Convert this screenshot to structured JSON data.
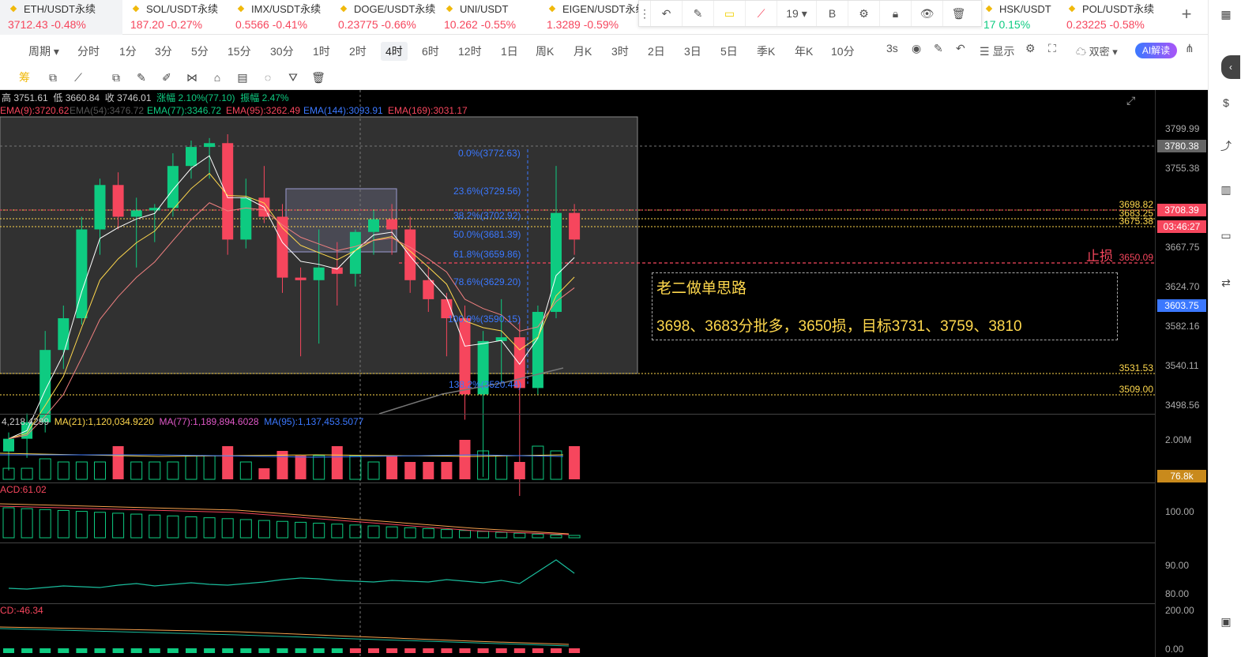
{
  "tickers": [
    {
      "symbol": "ETH/USDT永续",
      "price": "3712.43",
      "change": "-0.48%",
      "active": true
    },
    {
      "symbol": "SOL/USDT永续",
      "price": "187.20",
      "change": "-0.27%"
    },
    {
      "symbol": "IMX/USDT永续",
      "price": "0.5566",
      "change": "-0.41%"
    },
    {
      "symbol": "DOGE/USDT永续",
      "price": "0.23775",
      "change": "-0.66%"
    },
    {
      "symbol": "UNI/USDT",
      "price": "10.262",
      "change": "-0.55%"
    },
    {
      "symbol": "EIGEN/USDT永续",
      "price": "1.3289",
      "change": "-0.59%"
    },
    {
      "symbol": "HSK/USDT",
      "price": "17",
      "change": "0.15%"
    },
    {
      "symbol": "POL/USDT永续",
      "price": "0.23225",
      "change": "-0.58%"
    }
  ],
  "draw_toolbar": {
    "line_width": "19",
    "bold": "B"
  },
  "periods": [
    "周期",
    "分时",
    "1分",
    "3分",
    "5分",
    "15分",
    "30分",
    "1时",
    "2时",
    "4时",
    "6时",
    "12时",
    "1日",
    "周K",
    "月K",
    "3时",
    "2日",
    "3日",
    "5日",
    "季K",
    "年K",
    "10分"
  ],
  "selected_period": "4时",
  "toolbar_right": {
    "interval": "3s",
    "display": "显示",
    "dual": "双密",
    "ai": "AI解读"
  },
  "ohlc": {
    "high": "高 3751.61",
    "low": "低 3660.84",
    "close": "收 3746.01",
    "chg": "涨幅 2.10%(77.10)",
    "amp": "振幅 2.47%"
  },
  "emas": [
    {
      "label": "EMA(9):3720.62",
      "color": "#f6465d"
    },
    {
      "label": "EMA(54):3476.72",
      "color": "#555"
    },
    {
      "label": "EMA(77):3346.72",
      "color": "#0ecb81"
    },
    {
      "label": "EMA(95):3262.49",
      "color": "#f6465d"
    },
    {
      "label": "EMA(144):3093.91",
      "color": "#3b78ff"
    },
    {
      "label": "EMA(169):3031.17",
      "color": "#f6465d"
    }
  ],
  "price_axis": [
    "3799.99",
    "3755.38",
    "3667.75",
    "3624.70",
    "3582.16",
    "3540.11",
    "3498.56"
  ],
  "price_tags": [
    {
      "v": "3780.38",
      "c": "#666"
    },
    {
      "v": "3708.39",
      "c": "#f6465d"
    },
    {
      "v": "03:46:27",
      "c": "#f6465d"
    },
    {
      "v": "3603.75",
      "c": "#3b78ff"
    }
  ],
  "levels": [
    {
      "v": "3698.82",
      "c": "#ffd84d"
    },
    {
      "v": "3683.25",
      "c": "#ffd84d"
    },
    {
      "v": "3675.38",
      "c": "#ffd84d"
    },
    {
      "v": "3650.09",
      "c": "#f6465d"
    },
    {
      "v": "3531.53",
      "c": "#ffd84d"
    },
    {
      "v": "3509.00",
      "c": "#ffd84d"
    }
  ],
  "fib": [
    "0.0%(3772.63)",
    "23.6%(3729.56)",
    "38.2%(3702.92)",
    "50.0%(3681.39)",
    "61.8%(3659.86)",
    "78.6%(3629.20)",
    "100.0%(3590.15)",
    "138.2%(3520.44)"
  ],
  "stop_label": "止损",
  "plan": {
    "title": "老二做单思路",
    "detail": "3698、3683分批多，3650损，目标3731、3759、3810"
  },
  "volume": {
    "vol": "4,218.4299",
    "ma21": "MA(21):1,120,034.9220",
    "ma77": "MA(77):1,189,894.6028",
    "ma95": "MA(95):1,137,453.5077",
    "axis": "2.00M",
    "cur": "76.8k"
  },
  "macd": {
    "label": "ACD:61.02",
    "axis": "100.00"
  },
  "rsi": {
    "axis": [
      "90.00",
      "80.00"
    ]
  },
  "cd": {
    "label": "CD:-46.34",
    "axis": [
      "200.00",
      "0.00"
    ]
  },
  "candles": [
    {
      "o": 3545,
      "h": 3560,
      "l": 3530,
      "c": 3555
    },
    {
      "o": 3555,
      "h": 3575,
      "l": 3540,
      "c": 3568
    },
    {
      "o": 3568,
      "h": 3640,
      "l": 3560,
      "c": 3625
    },
    {
      "o": 3625,
      "h": 3660,
      "l": 3610,
      "c": 3650
    },
    {
      "o": 3650,
      "h": 3730,
      "l": 3645,
      "c": 3720
    },
    {
      "o": 3720,
      "h": 3760,
      "l": 3700,
      "c": 3755
    },
    {
      "o": 3755,
      "h": 3765,
      "l": 3720,
      "c": 3730
    },
    {
      "o": 3730,
      "h": 3745,
      "l": 3690,
      "c": 3735
    },
    {
      "o": 3735,
      "h": 3740,
      "l": 3710,
      "c": 3737
    },
    {
      "o": 3737,
      "h": 3780,
      "l": 3730,
      "c": 3770
    },
    {
      "o": 3770,
      "h": 3790,
      "l": 3760,
      "c": 3785
    },
    {
      "o": 3785,
      "h": 3792,
      "l": 3760,
      "c": 3788
    },
    {
      "o": 3788,
      "h": 3795,
      "l": 3700,
      "c": 3712
    },
    {
      "o": 3712,
      "h": 3760,
      "l": 3705,
      "c": 3745
    },
    {
      "o": 3745,
      "h": 3770,
      "l": 3725,
      "c": 3730
    },
    {
      "o": 3730,
      "h": 3740,
      "l": 3670,
      "c": 3682
    },
    {
      "o": 3682,
      "h": 3690,
      "l": 3620,
      "c": 3680
    },
    {
      "o": 3680,
      "h": 3720,
      "l": 3630,
      "c": 3690
    },
    {
      "o": 3690,
      "h": 3710,
      "l": 3660,
      "c": 3685
    },
    {
      "o": 3685,
      "h": 3720,
      "l": 3675,
      "c": 3718
    },
    {
      "o": 3718,
      "h": 3735,
      "l": 3700,
      "c": 3728
    },
    {
      "o": 3728,
      "h": 3740,
      "l": 3700,
      "c": 3720
    },
    {
      "o": 3720,
      "h": 3730,
      "l": 3670,
      "c": 3680
    },
    {
      "o": 3680,
      "h": 3690,
      "l": 3655,
      "c": 3665
    },
    {
      "o": 3665,
      "h": 3670,
      "l": 3620,
      "c": 3650
    },
    {
      "o": 3650,
      "h": 3660,
      "l": 3570,
      "c": 3590
    },
    {
      "o": 3590,
      "h": 3640,
      "l": 3525,
      "c": 3632
    },
    {
      "o": 3632,
      "h": 3665,
      "l": 3600,
      "c": 3635
    },
    {
      "o": 3635,
      "h": 3650,
      "l": 3510,
      "c": 3595
    },
    {
      "o": 3595,
      "h": 3660,
      "l": 3590,
      "c": 3655
    },
    {
      "o": 3655,
      "h": 3770,
      "l": 3650,
      "c": 3733
    },
    {
      "o": 3733,
      "h": 3740,
      "l": 3700,
      "c": 3712
    }
  ]
}
